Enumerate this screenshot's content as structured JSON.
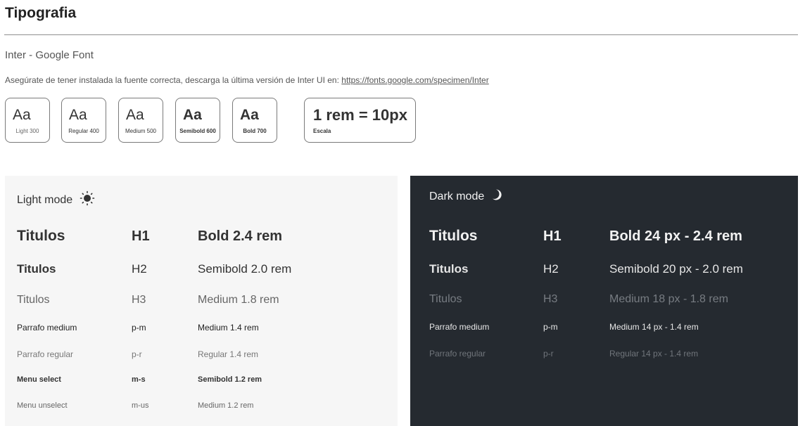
{
  "page": {
    "title": "Tipografia",
    "subtitle": "Inter - Google Font",
    "note": "Asegúrate de tener instalada la fuente correcta, descarga la última versión de Inter UI en: ",
    "link": "https://fonts.google.com/specimen/Inter"
  },
  "weights": [
    {
      "sample": "Aa",
      "label": "Light 300"
    },
    {
      "sample": "Aa",
      "label": "Regular 400"
    },
    {
      "sample": "Aa",
      "label": "Medium 500"
    },
    {
      "sample": "Aa",
      "label": "Semibold 600"
    },
    {
      "sample": "Aa",
      "label": "Bold 700"
    }
  ],
  "scale": {
    "value": "1 rem = 10px",
    "label": "Escala"
  },
  "light": {
    "title": "Light mode",
    "icon": "sun-icon",
    "rows": [
      {
        "name": "Titulos",
        "tag": "H1",
        "spec": "Bold 2.4 rem"
      },
      {
        "name": "Titulos",
        "tag": "H2",
        "spec": "Semibold 2.0 rem"
      },
      {
        "name": "Titulos",
        "tag": "H3",
        "spec": "Medium 1.8 rem"
      },
      {
        "name": "Parrafo medium",
        "tag": "p-m",
        "spec": "Medium 1.4 rem"
      },
      {
        "name": "Parrafo regular",
        "tag": "p-r",
        "spec": "Regular 1.4 rem"
      },
      {
        "name": "Menu select",
        "tag": "m-s",
        "spec": "Semibold 1.2 rem"
      },
      {
        "name": "Menu unselect",
        "tag": "m-us",
        "spec": "Medium 1.2 rem"
      }
    ]
  },
  "dark": {
    "title": "Dark mode",
    "icon": "moon-icon",
    "rows": [
      {
        "name": "Titulos",
        "tag": "H1",
        "spec": "Bold 24 px - 2.4 rem"
      },
      {
        "name": "Titulos",
        "tag": "H2",
        "spec": "Semibold 20 px - 2.0 rem"
      },
      {
        "name": "Titulos",
        "tag": "H3",
        "spec": "Medium 18 px - 1.8 rem"
      },
      {
        "name": "Parrafo medium",
        "tag": "p-m",
        "spec": "Medium 14 px - 1.4 rem"
      },
      {
        "name": "Parrafo regular",
        "tag": "p-r",
        "spec": "Regular 14 px - 1.4 rem"
      }
    ]
  },
  "colors": {
    "dark_bg": "#252a30",
    "light_bg": "#f6f6f6"
  }
}
